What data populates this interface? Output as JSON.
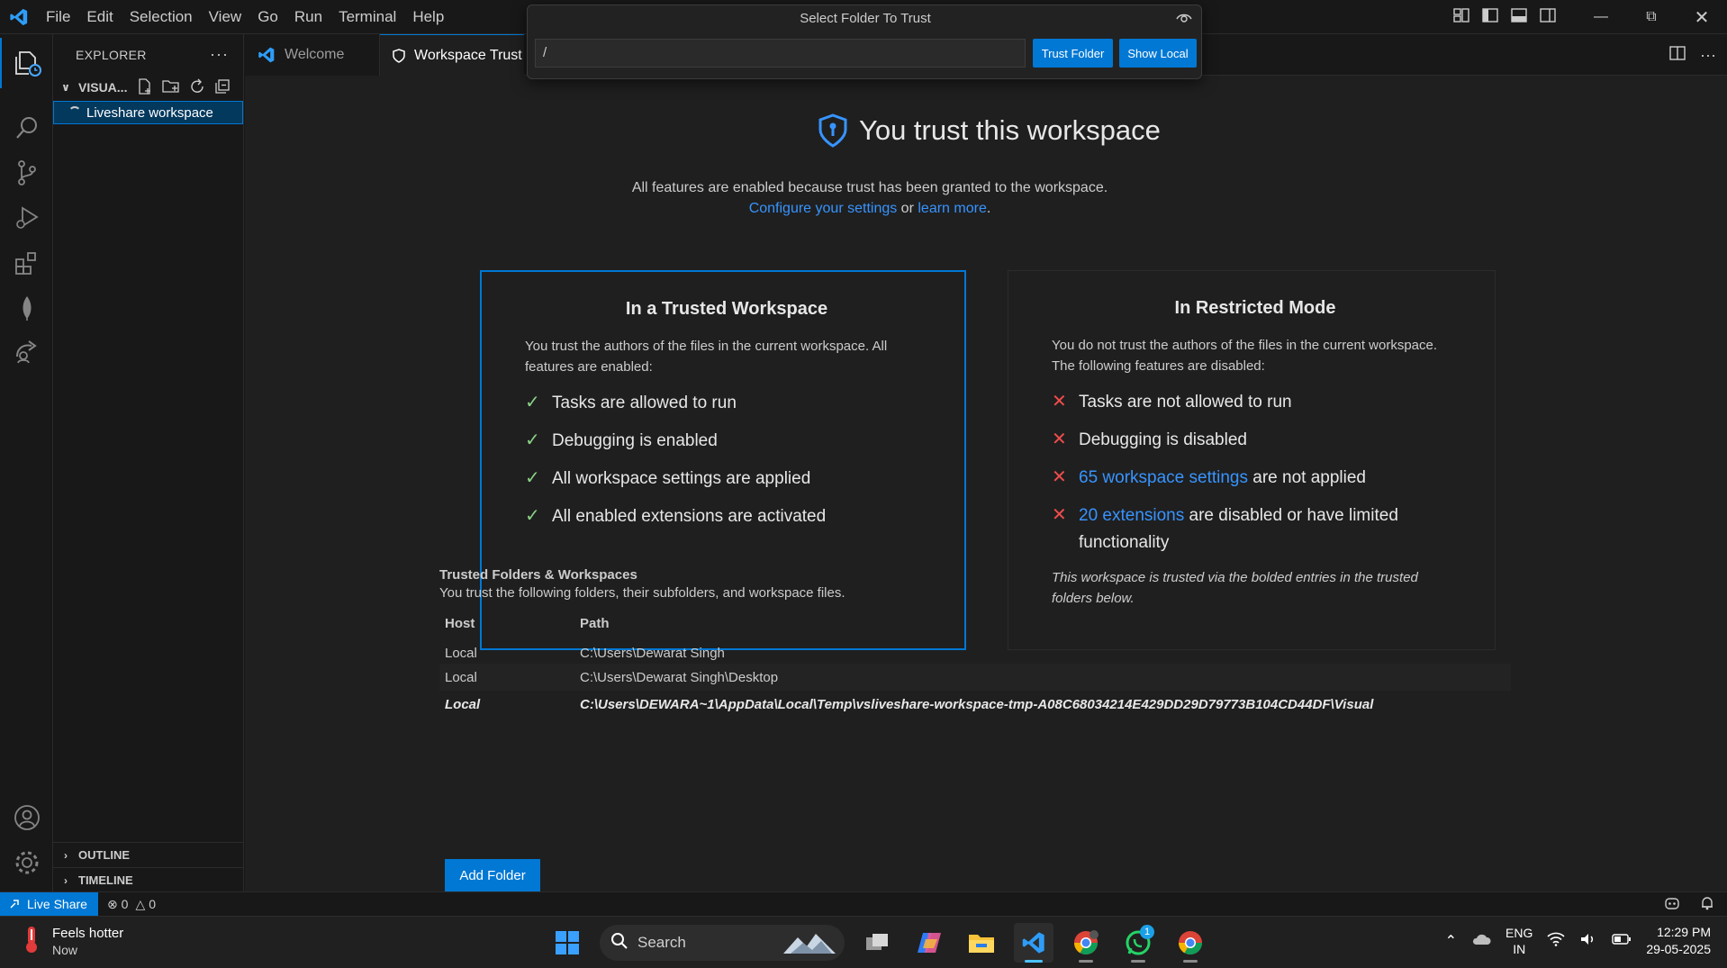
{
  "titlebar": {
    "menu": [
      "File",
      "Edit",
      "Selection",
      "View",
      "Go",
      "Run",
      "Terminal",
      "Help"
    ],
    "window_controls": [
      "minimize-icon",
      "restore-icon",
      "close-icon"
    ]
  },
  "quick_pick": {
    "title": "Select Folder To Trust",
    "input_value": "/",
    "trust_button": "Trust Folder",
    "show_local_button": "Show Local"
  },
  "sidebar": {
    "title": "EXPLORER",
    "section": "VISUA...",
    "tree_item": "Liveshare workspace",
    "outline": "OUTLINE",
    "timeline": "TIMELINE"
  },
  "tabs": [
    {
      "label": "Welcome",
      "active": false
    },
    {
      "label": "Workspace Trust",
      "active": true
    }
  ],
  "workspace_trust": {
    "title": "You trust this workspace",
    "subtitle_line1": "All features are enabled because trust has been granted to the workspace.",
    "configure_link": "Configure your settings",
    "or_text": " or ",
    "learn_more_link": "learn more",
    "period": ".",
    "trusted_card": {
      "title": "In a Trusted Workspace",
      "description": "You trust the authors of the files in the current workspace. All features are enabled:",
      "items": [
        "Tasks are allowed to run",
        "Debugging is enabled",
        "All workspace settings are applied",
        "All enabled extensions are activated"
      ]
    },
    "restricted_card": {
      "title": "In Restricted Mode",
      "description": "You do not trust the authors of the files in the current workspace. The following features are disabled:",
      "items": [
        {
          "link": "",
          "text": "Tasks are not allowed to run"
        },
        {
          "link": "",
          "text": "Debugging is disabled"
        },
        {
          "link": "65 workspace settings",
          "text": " are not applied"
        },
        {
          "link": "20 extensions",
          "text": " are disabled or have limited functionality"
        }
      ],
      "note": "This workspace is trusted via the bolded entries in the trusted folders below."
    },
    "folders": {
      "title": "Trusted Folders & Workspaces",
      "description": "You trust the following folders, their subfolders, and workspace files.",
      "columns": [
        "Host",
        "Path"
      ],
      "rows": [
        {
          "host": "Local",
          "path": "C:\\Users\\Dewarat Singh"
        },
        {
          "host": "Local",
          "path": "C:\\Users\\Dewarat Singh\\Desktop"
        },
        {
          "host": "Local",
          "path": "C:\\Users\\DEWARA~1\\AppData\\Local\\Temp\\vsliveshare-workspace-tmp-A08C68034214E429DD29D79773B104CD44DF\\Visual"
        }
      ],
      "add_button": "Add Folder"
    }
  },
  "statusbar": {
    "live_share": "Live Share",
    "errors": "0",
    "warnings": "0"
  },
  "taskbar": {
    "weather_title": "Feels hotter",
    "weather_sub": "Now",
    "search_placeholder": "Search",
    "whatsapp_badge": "1",
    "lang_line1": "ENG",
    "lang_line2": "IN",
    "time": "12:29 PM",
    "date": "29-05-2025"
  },
  "colors": {
    "accent": "#0078d4",
    "link": "#3794ff",
    "check": "#89d185",
    "cross": "#f14c4c",
    "editor_bg": "#1f1f1f"
  }
}
